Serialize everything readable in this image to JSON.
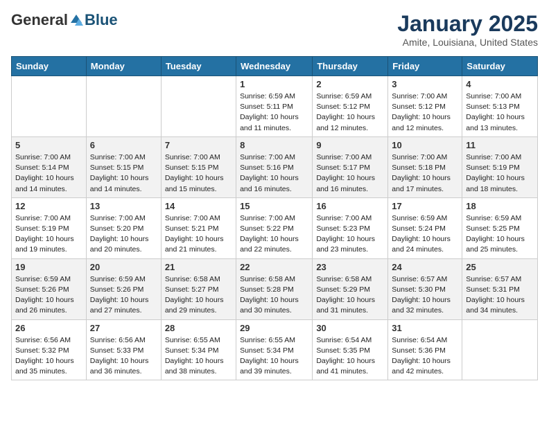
{
  "logo": {
    "general": "General",
    "blue": "Blue"
  },
  "header": {
    "month": "January 2025",
    "location": "Amite, Louisiana, United States"
  },
  "weekdays": [
    "Sunday",
    "Monday",
    "Tuesday",
    "Wednesday",
    "Thursday",
    "Friday",
    "Saturday"
  ],
  "weeks": [
    [
      {
        "day": "",
        "info": ""
      },
      {
        "day": "",
        "info": ""
      },
      {
        "day": "",
        "info": ""
      },
      {
        "day": "1",
        "info": "Sunrise: 6:59 AM\nSunset: 5:11 PM\nDaylight: 10 hours\nand 11 minutes."
      },
      {
        "day": "2",
        "info": "Sunrise: 6:59 AM\nSunset: 5:12 PM\nDaylight: 10 hours\nand 12 minutes."
      },
      {
        "day": "3",
        "info": "Sunrise: 7:00 AM\nSunset: 5:12 PM\nDaylight: 10 hours\nand 12 minutes."
      },
      {
        "day": "4",
        "info": "Sunrise: 7:00 AM\nSunset: 5:13 PM\nDaylight: 10 hours\nand 13 minutes."
      }
    ],
    [
      {
        "day": "5",
        "info": "Sunrise: 7:00 AM\nSunset: 5:14 PM\nDaylight: 10 hours\nand 14 minutes."
      },
      {
        "day": "6",
        "info": "Sunrise: 7:00 AM\nSunset: 5:15 PM\nDaylight: 10 hours\nand 14 minutes."
      },
      {
        "day": "7",
        "info": "Sunrise: 7:00 AM\nSunset: 5:15 PM\nDaylight: 10 hours\nand 15 minutes."
      },
      {
        "day": "8",
        "info": "Sunrise: 7:00 AM\nSunset: 5:16 PM\nDaylight: 10 hours\nand 16 minutes."
      },
      {
        "day": "9",
        "info": "Sunrise: 7:00 AM\nSunset: 5:17 PM\nDaylight: 10 hours\nand 16 minutes."
      },
      {
        "day": "10",
        "info": "Sunrise: 7:00 AM\nSunset: 5:18 PM\nDaylight: 10 hours\nand 17 minutes."
      },
      {
        "day": "11",
        "info": "Sunrise: 7:00 AM\nSunset: 5:19 PM\nDaylight: 10 hours\nand 18 minutes."
      }
    ],
    [
      {
        "day": "12",
        "info": "Sunrise: 7:00 AM\nSunset: 5:19 PM\nDaylight: 10 hours\nand 19 minutes."
      },
      {
        "day": "13",
        "info": "Sunrise: 7:00 AM\nSunset: 5:20 PM\nDaylight: 10 hours\nand 20 minutes."
      },
      {
        "day": "14",
        "info": "Sunrise: 7:00 AM\nSunset: 5:21 PM\nDaylight: 10 hours\nand 21 minutes."
      },
      {
        "day": "15",
        "info": "Sunrise: 7:00 AM\nSunset: 5:22 PM\nDaylight: 10 hours\nand 22 minutes."
      },
      {
        "day": "16",
        "info": "Sunrise: 7:00 AM\nSunset: 5:23 PM\nDaylight: 10 hours\nand 23 minutes."
      },
      {
        "day": "17",
        "info": "Sunrise: 6:59 AM\nSunset: 5:24 PM\nDaylight: 10 hours\nand 24 minutes."
      },
      {
        "day": "18",
        "info": "Sunrise: 6:59 AM\nSunset: 5:25 PM\nDaylight: 10 hours\nand 25 minutes."
      }
    ],
    [
      {
        "day": "19",
        "info": "Sunrise: 6:59 AM\nSunset: 5:26 PM\nDaylight: 10 hours\nand 26 minutes."
      },
      {
        "day": "20",
        "info": "Sunrise: 6:59 AM\nSunset: 5:26 PM\nDaylight: 10 hours\nand 27 minutes."
      },
      {
        "day": "21",
        "info": "Sunrise: 6:58 AM\nSunset: 5:27 PM\nDaylight: 10 hours\nand 29 minutes."
      },
      {
        "day": "22",
        "info": "Sunrise: 6:58 AM\nSunset: 5:28 PM\nDaylight: 10 hours\nand 30 minutes."
      },
      {
        "day": "23",
        "info": "Sunrise: 6:58 AM\nSunset: 5:29 PM\nDaylight: 10 hours\nand 31 minutes."
      },
      {
        "day": "24",
        "info": "Sunrise: 6:57 AM\nSunset: 5:30 PM\nDaylight: 10 hours\nand 32 minutes."
      },
      {
        "day": "25",
        "info": "Sunrise: 6:57 AM\nSunset: 5:31 PM\nDaylight: 10 hours\nand 34 minutes."
      }
    ],
    [
      {
        "day": "26",
        "info": "Sunrise: 6:56 AM\nSunset: 5:32 PM\nDaylight: 10 hours\nand 35 minutes."
      },
      {
        "day": "27",
        "info": "Sunrise: 6:56 AM\nSunset: 5:33 PM\nDaylight: 10 hours\nand 36 minutes."
      },
      {
        "day": "28",
        "info": "Sunrise: 6:55 AM\nSunset: 5:34 PM\nDaylight: 10 hours\nand 38 minutes."
      },
      {
        "day": "29",
        "info": "Sunrise: 6:55 AM\nSunset: 5:34 PM\nDaylight: 10 hours\nand 39 minutes."
      },
      {
        "day": "30",
        "info": "Sunrise: 6:54 AM\nSunset: 5:35 PM\nDaylight: 10 hours\nand 41 minutes."
      },
      {
        "day": "31",
        "info": "Sunrise: 6:54 AM\nSunset: 5:36 PM\nDaylight: 10 hours\nand 42 minutes."
      },
      {
        "day": "",
        "info": ""
      }
    ]
  ]
}
